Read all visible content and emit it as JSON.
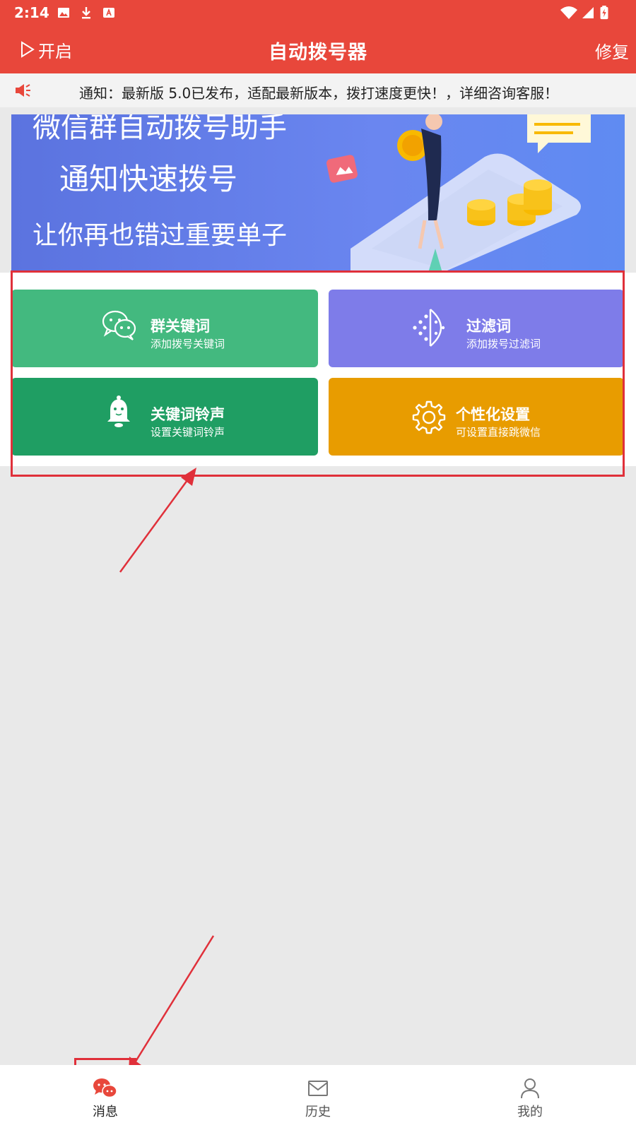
{
  "status_bar": {
    "time": "2:14"
  },
  "header": {
    "start_label": "开启",
    "title": "自动拨号器",
    "repair_label": "修复"
  },
  "notice": {
    "text": "通知：最新版 5.0已发布，适配最新版本，拨打速度更快！，详细咨询客服！"
  },
  "banner": {
    "line1": "微信群自动拨号助手",
    "line2": "通知快速拨号",
    "line3": "让你再也错过重要单子"
  },
  "cards": [
    {
      "title": "群关键词",
      "subtitle": "添加拨号关键词",
      "icon": "wechat-icon",
      "color": "#43b97f"
    },
    {
      "title": "过滤词",
      "subtitle": "添加拨号过滤词",
      "icon": "filter-icon",
      "color": "#7e7ce9"
    },
    {
      "title": "关键词铃声",
      "subtitle": "设置关键词铃声",
      "icon": "bell-icon",
      "color": "#1f9e63"
    },
    {
      "title": "个性化设置",
      "subtitle": "可设置直接跳微信",
      "icon": "gear-icon",
      "color": "#e89c00"
    }
  ],
  "tabbar": {
    "items": [
      {
        "label": "消息",
        "icon": "message-icon",
        "active": true
      },
      {
        "label": "历史",
        "icon": "mail-icon",
        "active": false
      },
      {
        "label": "我的",
        "icon": "user-icon",
        "active": false
      }
    ]
  },
  "colors": {
    "accent": "#e8473b",
    "annotation": "#e0303a"
  }
}
